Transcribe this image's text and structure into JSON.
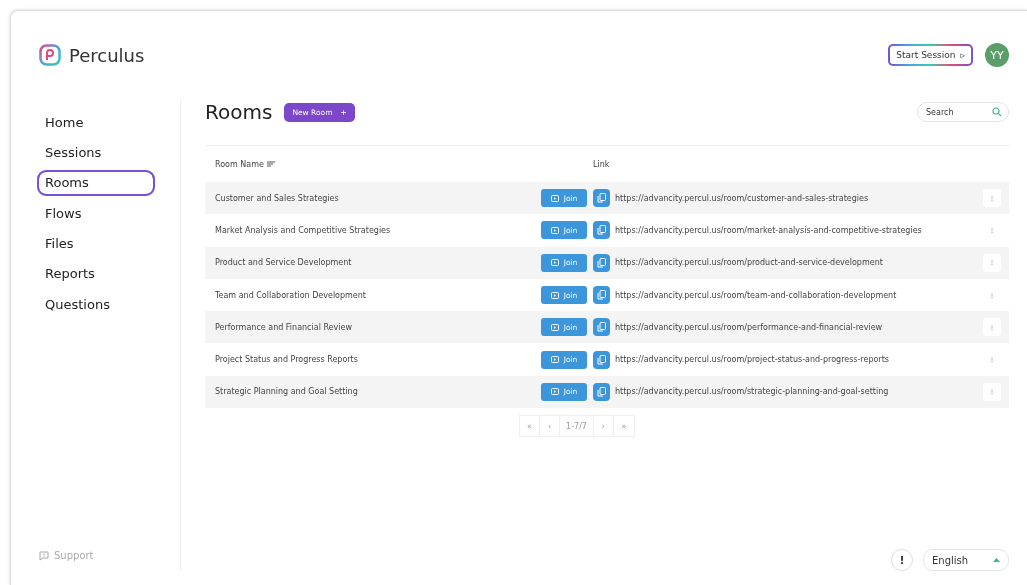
{
  "brand": {
    "name": "Perculus"
  },
  "header": {
    "start_session": "Start Session",
    "start_icon": "▹",
    "avatar": "YY"
  },
  "sidebar": {
    "items": [
      {
        "label": "Home",
        "selected": false
      },
      {
        "label": "Sessions",
        "selected": false
      },
      {
        "label": "Rooms",
        "selected": true
      },
      {
        "label": "Flows",
        "selected": false
      },
      {
        "label": "Files",
        "selected": false
      },
      {
        "label": "Reports",
        "selected": false
      },
      {
        "label": "Questions",
        "selected": false
      }
    ],
    "support": "Support"
  },
  "page": {
    "title": "Rooms",
    "new_button": "New Room",
    "new_icon": "+",
    "search": {
      "placeholder": "Search"
    }
  },
  "table": {
    "columns": [
      "Room Name",
      "Link"
    ],
    "rows": [
      {
        "name": "Customer and Sales Strategies",
        "join": "Join",
        "link": "https://advancity.percul.us/room/customer-and-sales-strategies",
        "more": "⁝"
      },
      {
        "name": "Market Analysis and Competitive Strategies",
        "join": "Join",
        "link": "https://advancity.percul.us/room/market-analysis-and-competitive-strategies",
        "more": "⁝"
      },
      {
        "name": "Product and Service Development",
        "join": "Join",
        "link": "https://advancity.percul.us/room/product-and-service-development",
        "more": "⁝"
      },
      {
        "name": "Team and Collaboration Development",
        "join": "Join",
        "link": "https://advancity.percul.us/room/team-and-collaboration-development",
        "more": "⁝"
      },
      {
        "name": "Performance and Financial Review",
        "join": "Join",
        "link": "https://advancity.percul.us/room/performance-and-financial-review",
        "more": "⁝"
      },
      {
        "name": "Project Status and Progress Reports",
        "join": "Join",
        "link": "https://advancity.percul.us/room/project-status-and-progress-reports",
        "more": "⁝"
      },
      {
        "name": "Strategic Planning and Goal Setting",
        "join": "Join",
        "link": "https://advancity.percul.us/room/strategic-planning-and-goal-setting",
        "more": "⁝"
      }
    ]
  },
  "pagination": {
    "first": "«",
    "prev": "‹",
    "range": "1-7/7",
    "next": "›",
    "last": "»"
  },
  "footer": {
    "help": "!",
    "language": "English"
  }
}
